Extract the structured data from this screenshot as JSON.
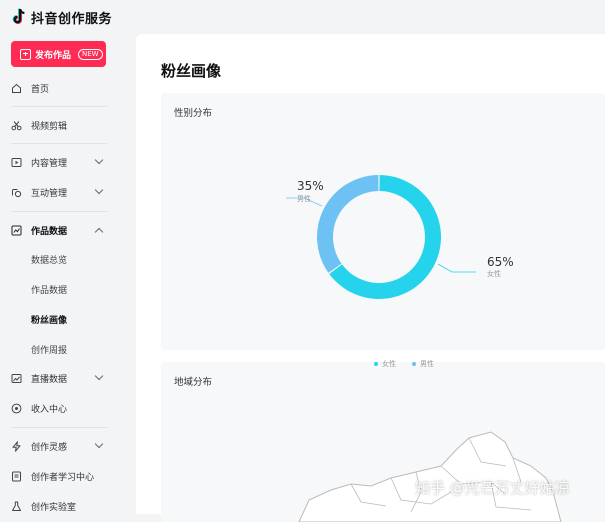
{
  "app": {
    "title": "抖音创作服务"
  },
  "publish": {
    "label": "发布作品",
    "badge": "NEW"
  },
  "nav": {
    "home": "首页",
    "video_edit": "视频剪辑",
    "content_mgmt": "内容管理",
    "interaction_mgmt": "互动管理",
    "works_data": "作品数据",
    "sub_items": [
      "数据总览",
      "作品数据",
      "粉丝画像",
      "创作周报"
    ],
    "live_data": "直播数据",
    "income": "收入中心",
    "inspiration": "创作灵感",
    "learning": "创作者学习中心",
    "lab": "创作实验室"
  },
  "page": {
    "title": "粉丝画像"
  },
  "gender_card": {
    "title": "性别分布"
  },
  "region_card": {
    "title": "地域分布"
  },
  "chart_data": {
    "type": "pie",
    "title": "性别分布",
    "categories": [
      "女性",
      "男性"
    ],
    "values": [
      65,
      35
    ],
    "labels": [
      "65%",
      "35%"
    ],
    "colors": [
      "#25d4ec",
      "#6ec2f3"
    ],
    "legend": "bottom"
  },
  "watermark": "知乎 @光芒万丈好姑凉"
}
